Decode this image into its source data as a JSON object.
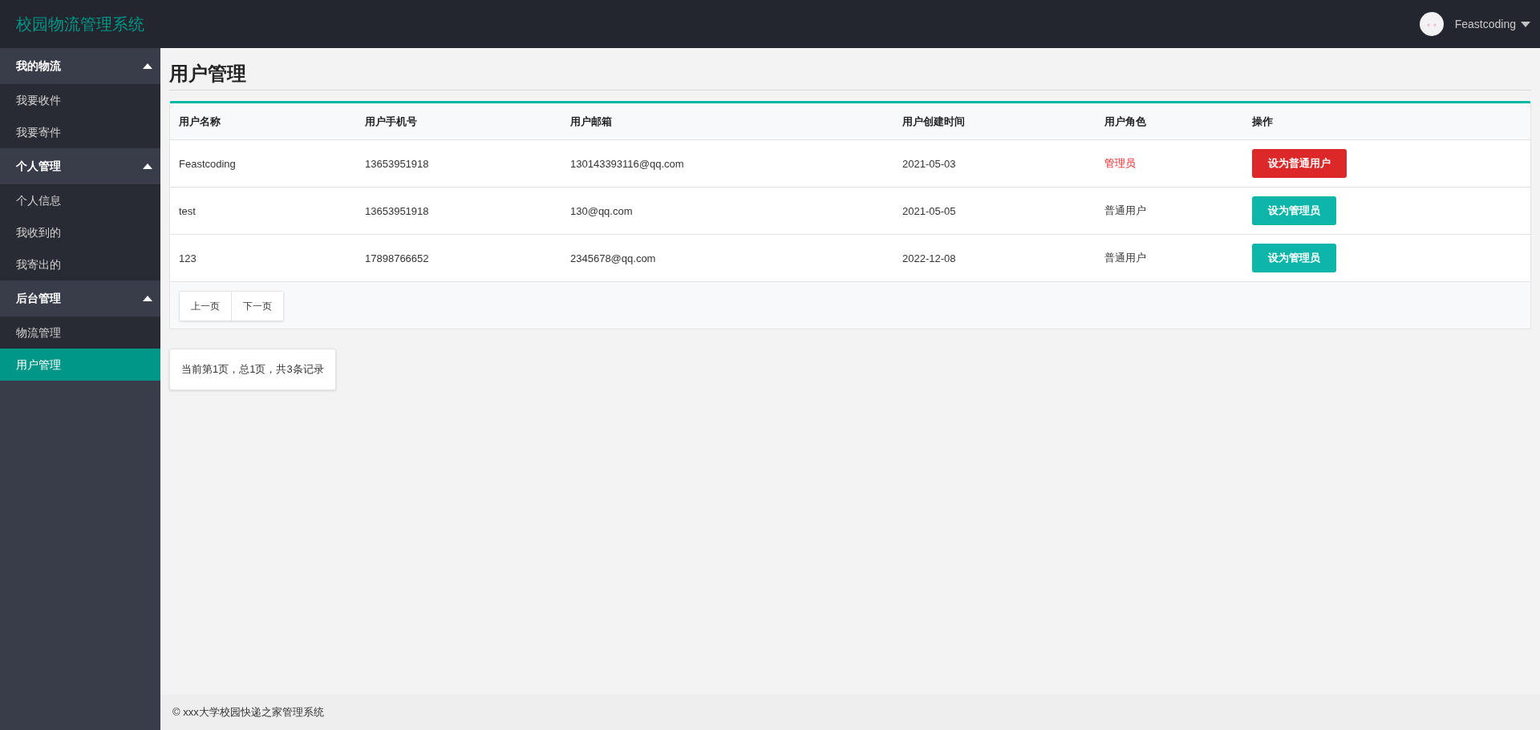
{
  "header": {
    "logo": "校园物流管理系统",
    "user": {
      "name": "Feastcoding"
    }
  },
  "sidebar": {
    "groups": [
      {
        "title": "我的物流",
        "expanded": true,
        "items": [
          {
            "label": "我要收件",
            "selected": false
          },
          {
            "label": "我要寄件",
            "selected": false
          }
        ]
      },
      {
        "title": "个人管理",
        "expanded": true,
        "items": [
          {
            "label": "个人信息",
            "selected": false
          },
          {
            "label": "我收到的",
            "selected": false
          },
          {
            "label": "我寄出的",
            "selected": false
          }
        ]
      },
      {
        "title": "后台管理",
        "expanded": true,
        "items": [
          {
            "label": "物流管理",
            "selected": false
          },
          {
            "label": "用户管理",
            "selected": true
          }
        ]
      }
    ]
  },
  "page": {
    "title": "用户管理"
  },
  "table": {
    "columns": [
      "用户名称",
      "用户手机号",
      "用户邮箱",
      "用户创建时间",
      "用户角色",
      "操作"
    ],
    "rows": [
      {
        "kind": "admin",
        "cells": [
          "Feastcoding",
          "13653951918",
          "130143393116@qq.com",
          "2021-05-03",
          "管理员"
        ],
        "action": "设为普通用户"
      },
      {
        "kind": "user",
        "cells": [
          "test",
          "13653951918",
          "130@qq.com",
          "2021-05-05",
          "普通用户"
        ],
        "action": "设为管理员"
      },
      {
        "kind": "user",
        "cells": [
          "123",
          "17898766652",
          "2345678@qq.com",
          "2022-12-08",
          "普通用户"
        ],
        "action": "设为管理员"
      }
    ],
    "pager": [
      "上一页",
      "下一页"
    ]
  },
  "summary": "当前第1页，总1页，共3条记录",
  "footer": "© xxx大学校园快递之家管理系统"
}
